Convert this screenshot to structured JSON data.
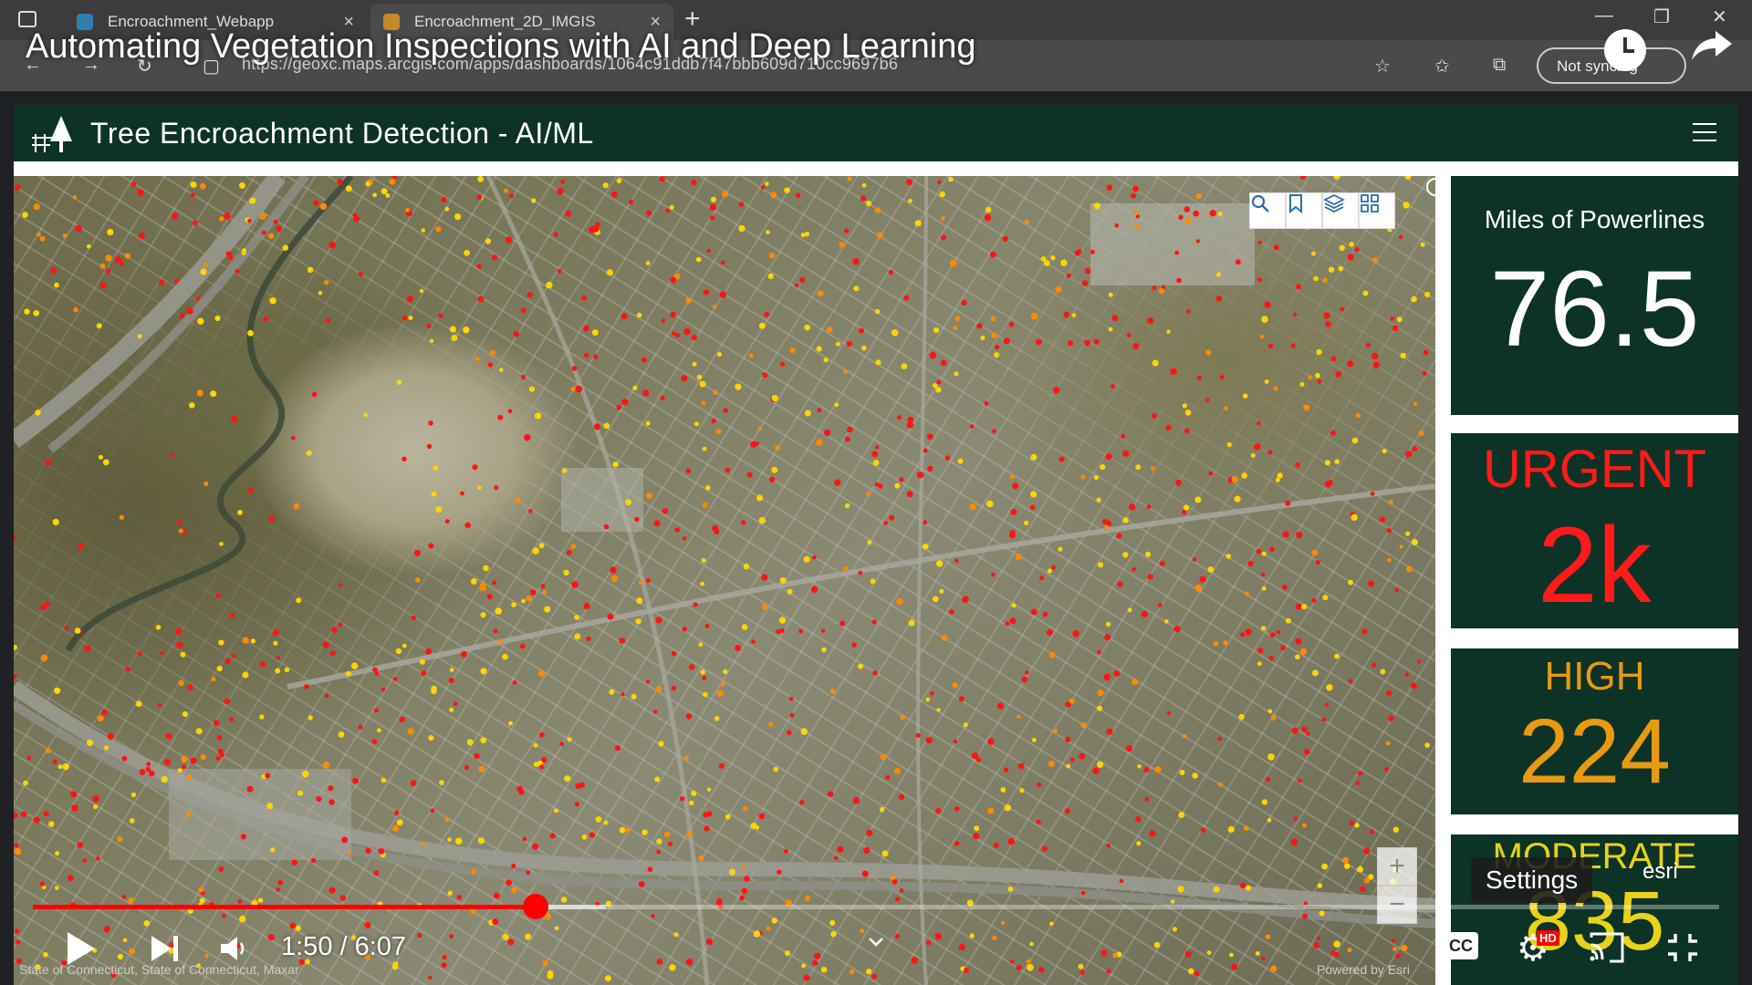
{
  "browser": {
    "tabs": [
      {
        "label": "Encroachment_Webapp",
        "active": false
      },
      {
        "label": "Encroachment_2D_IMGIS",
        "active": true
      }
    ],
    "url": "https://geoxc.maps.arcgis.com/apps/dashboards/1064c91ddb7f47bbb609d710cc9697b6",
    "sync_label": "Not syncing",
    "new_tab_icon": "plus-icon"
  },
  "video": {
    "title": "Automating Vegetation Inspections with AI and Deep Learning",
    "time": "1:50 / 6:07",
    "progress": 0.298,
    "loaded": 0.34,
    "settings_tooltip": "Settings",
    "hd_badge": "HD",
    "cc_label": "CC"
  },
  "dashboard": {
    "title": "Tree Encroachment Detection - AI/ML",
    "header_color": "#0d3326",
    "map": {
      "attribution_left": "State of Connecticut, State of Connecticut, Maxar",
      "attribution_right": "Powered by Esri",
      "esri_logo": "esri",
      "zoom_in": "+",
      "zoom_out": "−",
      "tools": [
        "search-icon",
        "bookmark-icon",
        "layers-icon",
        "basemap-gallery-icon"
      ]
    },
    "indicators": {
      "miles": {
        "label": "Miles of Powerlines",
        "value": "76.5",
        "color": "#ffffff"
      },
      "urgent": {
        "label": "URGENT",
        "value": "2k",
        "color": "#ff1a1a"
      },
      "high": {
        "label": "HIGH",
        "value": "224",
        "color": "#e89a10"
      },
      "moderate": {
        "label": "MODERATE",
        "value": "835",
        "color": "#e8d21a"
      }
    }
  }
}
